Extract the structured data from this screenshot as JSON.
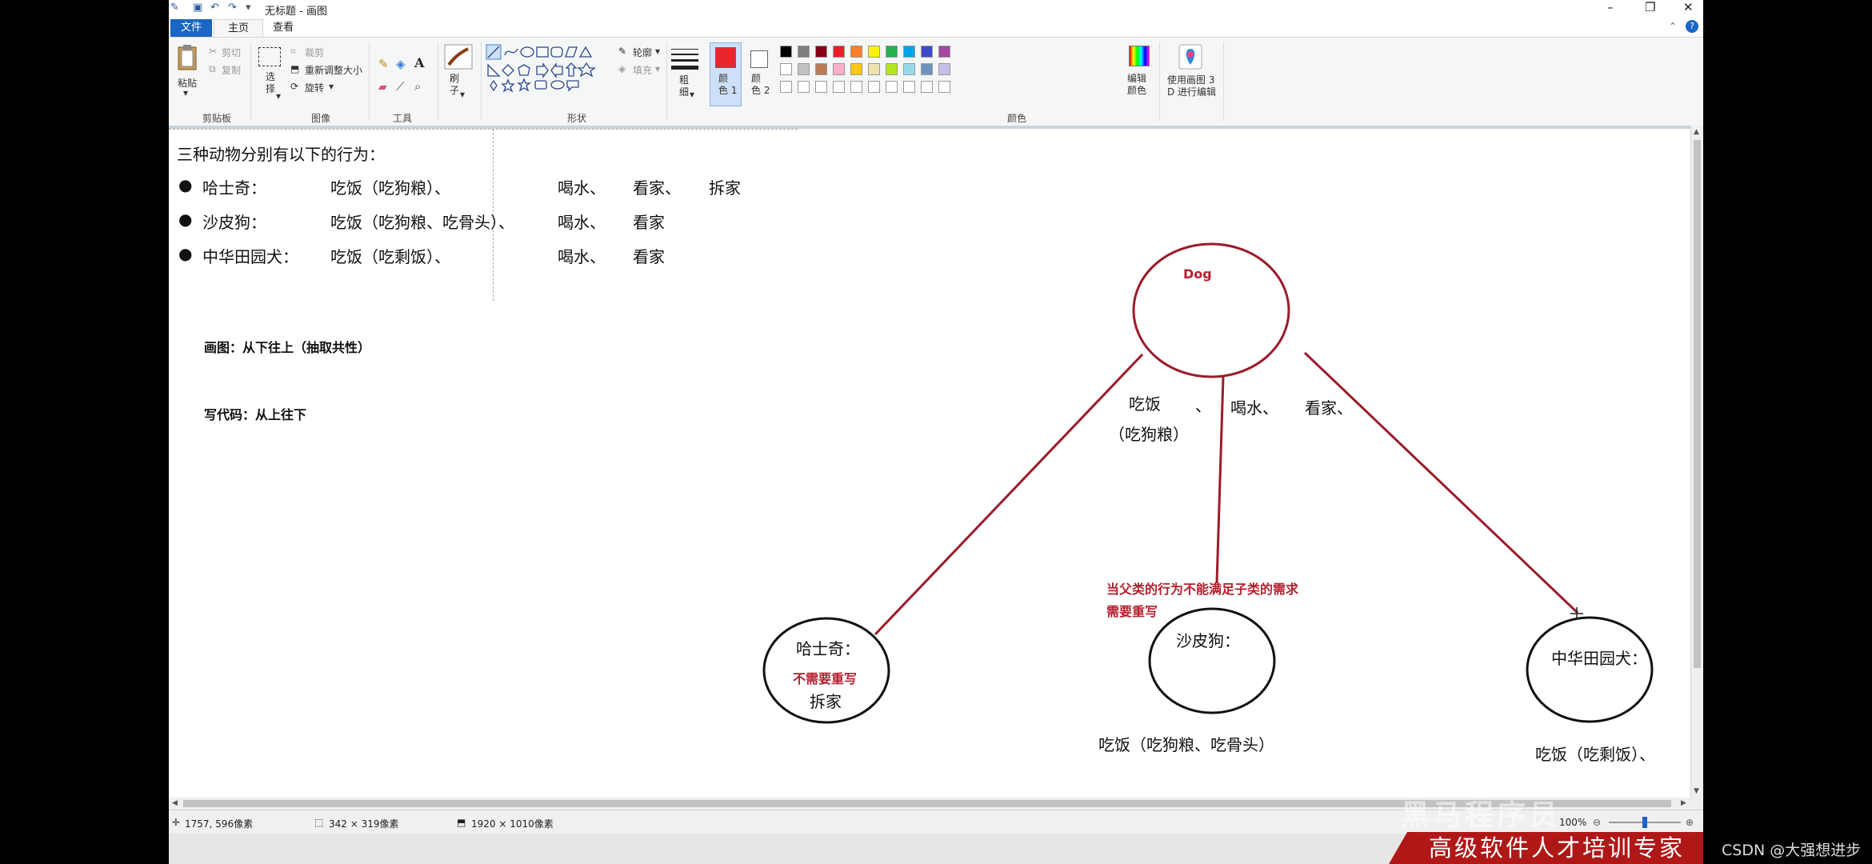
{
  "window": {
    "title": "无标题 - 画图",
    "controls": {
      "minimize": "–",
      "restore": "❐",
      "close": "✕"
    },
    "help": "?"
  },
  "tabs": {
    "file": "文件",
    "home": "主页",
    "view": "查看"
  },
  "ribbon": {
    "clipboard": {
      "paste": "粘贴",
      "cut": "剪切",
      "copy": "复制",
      "group": "剪贴板"
    },
    "image": {
      "select": "选\n择",
      "crop": "裁剪",
      "resize": "重新调整大小",
      "rotate": "旋转",
      "group": "图像"
    },
    "tools": {
      "group": "工具",
      "text_tool": "A"
    },
    "brushes": {
      "label": "刷\n子"
    },
    "shapes": {
      "outline": "轮廓",
      "fill": "填充",
      "group": "形状"
    },
    "size": {
      "label": "粗\n细"
    },
    "color1": {
      "label": "颜\n色 1",
      "value": "#e8262b"
    },
    "color2": {
      "label": "颜\n色 2",
      "value": "#ffffff"
    },
    "colors": {
      "group": "颜色",
      "edit": "编辑\n颜色",
      "palette_row1": [
        "#000000",
        "#7f7f7f",
        "#880015",
        "#ed1c24",
        "#ff7f27",
        "#fff200",
        "#22b14c",
        "#00a2e8",
        "#3f48cc",
        "#a349a4"
      ],
      "palette_row2": [
        "#ffffff",
        "#c3c3c3",
        "#b97a57",
        "#ffaec9",
        "#ffc90e",
        "#efe4b0",
        "#b5e61d",
        "#99d9ea",
        "#7092be",
        "#c8bfe7"
      ],
      "palette_row3": [
        "#ffffff",
        "#ffffff",
        "#ffffff",
        "#ffffff",
        "#ffffff",
        "#ffffff",
        "#ffffff",
        "#ffffff",
        "#ffffff",
        "#ffffff"
      ]
    },
    "paint3d": {
      "label": "使用画图 3\nD 进行编辑"
    }
  },
  "content": {
    "heading": "三种动物分别有以下的行为：",
    "rows": [
      {
        "name": "哈士奇：",
        "eat": "吃饭（吃狗粮）、",
        "drink": "喝水、",
        "guard": "看家、",
        "extra": "拆家"
      },
      {
        "name": "沙皮狗：",
        "eat": "吃饭（吃狗粮、吃骨头）、",
        "drink": "喝水、",
        "guard": "看家",
        "extra": ""
      },
      {
        "name": "中华田园犬：",
        "eat": "吃饭（吃剩饭）、",
        "drink": "喝水、",
        "guard": "看家",
        "extra": ""
      }
    ],
    "note1": "画图：从下往上（抽取共性）",
    "note2": "写代码：从上往下"
  },
  "diagram": {
    "parent": {
      "label": "Dog"
    },
    "parent_behaviors": {
      "eat": "吃饭",
      "sep": "、",
      "eat_detail": "（吃狗粮）",
      "drink": "喝水、",
      "guard": "看家、"
    },
    "husky": {
      "label": "哈士奇：",
      "note": "不需要重写",
      "behavior": "拆家"
    },
    "sharpei": {
      "label": "沙皮狗：",
      "note_line1": "当父类的行为不能满足子类的需求",
      "note_line2": "需要重写",
      "behavior": "吃饭（吃狗粮、吃骨头）"
    },
    "rural": {
      "label": "中华田园犬：",
      "behavior": "吃饭（吃剩饭）、"
    },
    "stroke_color": "#9b1b2a",
    "note_color": "#b5202e"
  },
  "status": {
    "cursor": "1757, 596像素",
    "selection": "342 × 319像素",
    "canvas_size": "1920 × 1010像素",
    "zoom": "100%"
  },
  "overlay": {
    "banner": "高级软件人才培训专家",
    "watermark": "黑马程序员",
    "csdn": "CSDN @大强想进步"
  }
}
